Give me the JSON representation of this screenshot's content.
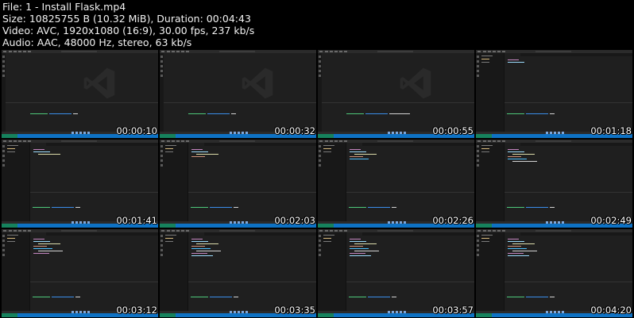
{
  "info": {
    "file": "File: 1 - Install Flask.mp4",
    "size": "Size: 10825755 B (10.32 MiB), Duration: 00:04:43",
    "video": "Video: AVC, 1920x1080 (16:9), 30.00 fps, 237 kb/s",
    "audio": "Audio: AAC, 48000 Hz, stereo, 63 kb/s"
  },
  "colors": {
    "background": "#000000",
    "editor": "#1f1f1f",
    "statusbar": "#0e72c4",
    "terminal_prompt": "#4ec97a",
    "terminal_path": "#3b8eea"
  },
  "thumbnails": [
    {
      "time": "00:00:10",
      "view": "welcome"
    },
    {
      "time": "00:00:32",
      "view": "welcome"
    },
    {
      "time": "00:00:55",
      "view": "welcome"
    },
    {
      "time": "00:01:18",
      "view": "editor"
    },
    {
      "time": "00:01:41",
      "view": "editor"
    },
    {
      "time": "00:02:03",
      "view": "editor"
    },
    {
      "time": "00:02:26",
      "view": "editor"
    },
    {
      "time": "00:02:49",
      "view": "editor"
    },
    {
      "time": "00:03:12",
      "view": "editor"
    },
    {
      "time": "00:03:35",
      "view": "editor"
    },
    {
      "time": "00:03:57",
      "view": "editor"
    },
    {
      "time": "00:04:20",
      "view": "editor"
    }
  ]
}
